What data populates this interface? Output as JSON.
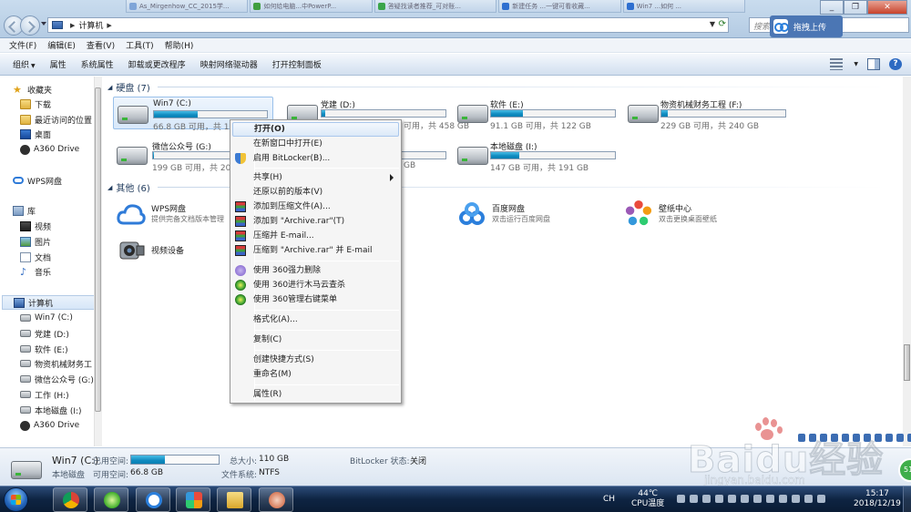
{
  "browser_tabs": [
    {
      "label": "As_Mirgenhow_CC_2015学...",
      "color": "#7fa5d8"
    },
    {
      "label": "如何给电脑...中PowerP...",
      "color": "#3f9e3f"
    },
    {
      "label": "答疑找读者推荐_可对账...",
      "color": "#3aa54a"
    },
    {
      "label": "新建任务 ...一键可看收藏...",
      "color": "#2e6fd0"
    },
    {
      "label": "Win7 ...如何 ...",
      "color": "#2e6fd0"
    }
  ],
  "address": {
    "root_label": "计算机",
    "search_placeholder": "搜索"
  },
  "upload_widget": {
    "label": "拖拽上传"
  },
  "menubar": [
    "文件(F)",
    "编辑(E)",
    "查看(V)",
    "工具(T)",
    "帮助(H)"
  ],
  "cmdbar": {
    "organize": "组织",
    "items": [
      "属性",
      "系统属性",
      "卸载或更改程序",
      "映射网络驱动器",
      "打开控制面板"
    ]
  },
  "nav": {
    "favorites": "收藏夹",
    "fav_items": [
      "下载",
      "最近访问的位置",
      "桌面",
      "A360 Drive"
    ],
    "wps": "WPS网盘",
    "libraries": "库",
    "lib_items": [
      "视频",
      "图片",
      "文档",
      "音乐"
    ],
    "computer": "计算机",
    "drives": [
      "Win7 (C:)",
      "党建 (D:)",
      "软件 (E:)",
      "物资机械财务工",
      "微信公众号 (G:)",
      "工作 (H:)",
      "本地磁盘 (I:)",
      "A360 Drive"
    ]
  },
  "groups": {
    "hard_disks": "硬盘 (7)",
    "others": "其他 (6)"
  },
  "drives": [
    {
      "name": "Win7 (C:)",
      "free": "66.8 GB 可用，共 110 GB",
      "used_fraction": 0.39,
      "selected": true
    },
    {
      "name": "党建 (D:)",
      "free": "可用，共 458 GB",
      "used_fraction": 0.03,
      "selected": false
    },
    {
      "name": "软件 (E:)",
      "free": "91.1 GB 可用，共 122 GB",
      "used_fraction": 0.26,
      "selected": false
    },
    {
      "name": "物资机械财务工程 (F:)",
      "free": "229 GB 可用，共 240 GB",
      "used_fraction": 0.05,
      "selected": false
    },
    {
      "name": "微信公众号 (G:)",
      "free": "199 GB 可用，共 200 GB",
      "used_fraction": 0.01,
      "selected": false
    },
    {
      "name": "",
      "free": "GB",
      "used_fraction": 0.03,
      "selected": false
    },
    {
      "name": "本地磁盘 (I:)",
      "free": "147 GB 可用，共 191 GB",
      "used_fraction": 0.23,
      "selected": false
    }
  ],
  "others": [
    {
      "name": "WPS网盘",
      "desc": "提供完备文档版本管理",
      "icon": "wps-cloud"
    },
    {
      "name": "百度网盘",
      "desc": "双击运行百度网盘",
      "icon": "baidu-netdisk"
    },
    {
      "name": "壁纸中心",
      "desc": "双击更换桌面壁纸",
      "icon": "wallpaper"
    },
    {
      "name": "视频设备",
      "desc": "",
      "icon": "webcam"
    }
  ],
  "context_menu": {
    "open": "打开(O)",
    "open_new_window": "在新窗口中打开(E)",
    "bitlocker": "启用 BitLocker(B)...",
    "share": "共享(H)",
    "restore": "还原以前的版本(V)",
    "add_archive": "添加到压缩文件(A)...",
    "add_rar": "添加到 \"Archive.rar\"(T)",
    "compress_email": "压缩并 E-mail...",
    "compress_rar_email": "压缩到 \"Archive.rar\" 并 E-mail",
    "force_delete": "使用 360强力删除",
    "trojan_scan": "使用 360进行木马云查杀",
    "manage_menu": "使用 360管理右键菜单",
    "format": "格式化(A)...",
    "copy": "复制(C)",
    "shortcut": "创建快捷方式(S)",
    "rename": "重命名(M)",
    "properties": "属性(R)"
  },
  "details": {
    "name": "Win7 (C:)",
    "type": "本地磁盘",
    "used_label": "已用空间:",
    "free_label": "可用空间:",
    "free_value": "66.8 GB",
    "total_label": "总大小:",
    "total_value": "110 GB",
    "fs_label": "文件系统:",
    "fs_value": "NTFS",
    "bitlocker_label": "BitLocker 状态:",
    "bitlocker_value": "关闭",
    "used_fraction": 0.39
  },
  "watermark": {
    "text": "Baidu经验",
    "url": "jingyan.baidu.com"
  },
  "taskbar": {
    "ime": "CH",
    "temp": "44℃",
    "temp_label": "CPU温度",
    "time": "15:17",
    "date": "2018/12/19",
    "badge": "51"
  }
}
